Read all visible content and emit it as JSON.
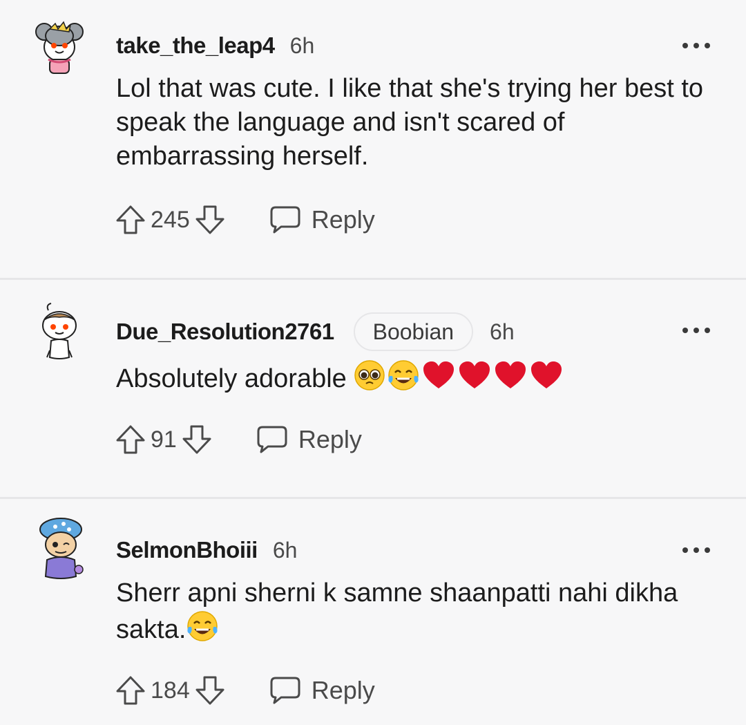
{
  "comments": [
    {
      "username": "take_the_leap4",
      "flair": "",
      "time": "6h",
      "text": "Lol that was cute. I like that she's trying her best to speak the language and isn't scared of embarrassing herself.",
      "emojis": [],
      "votes": "245",
      "reply_label": "Reply"
    },
    {
      "username": "Due_Resolution2761",
      "flair": "Boobian",
      "time": "6h",
      "text": "Absolutely adorable ",
      "emojis": [
        "pleading-face",
        "tears-of-joy",
        "red-heart",
        "red-heart",
        "red-heart",
        "red-heart"
      ],
      "votes": "91",
      "reply_label": "Reply"
    },
    {
      "username": "SelmonBhoiii",
      "flair": "",
      "time": "6h",
      "text": "Sherr apni sherni k samne shaanpatti nahi dikha sakta.",
      "emojis": [
        "tears-of-joy"
      ],
      "votes": "184",
      "reply_label": "Reply"
    }
  ],
  "colors": {
    "background": "#f7f7f8",
    "divider": "#e6e6e8",
    "text": "#1c1c1c",
    "muted": "#4a4a4a"
  }
}
